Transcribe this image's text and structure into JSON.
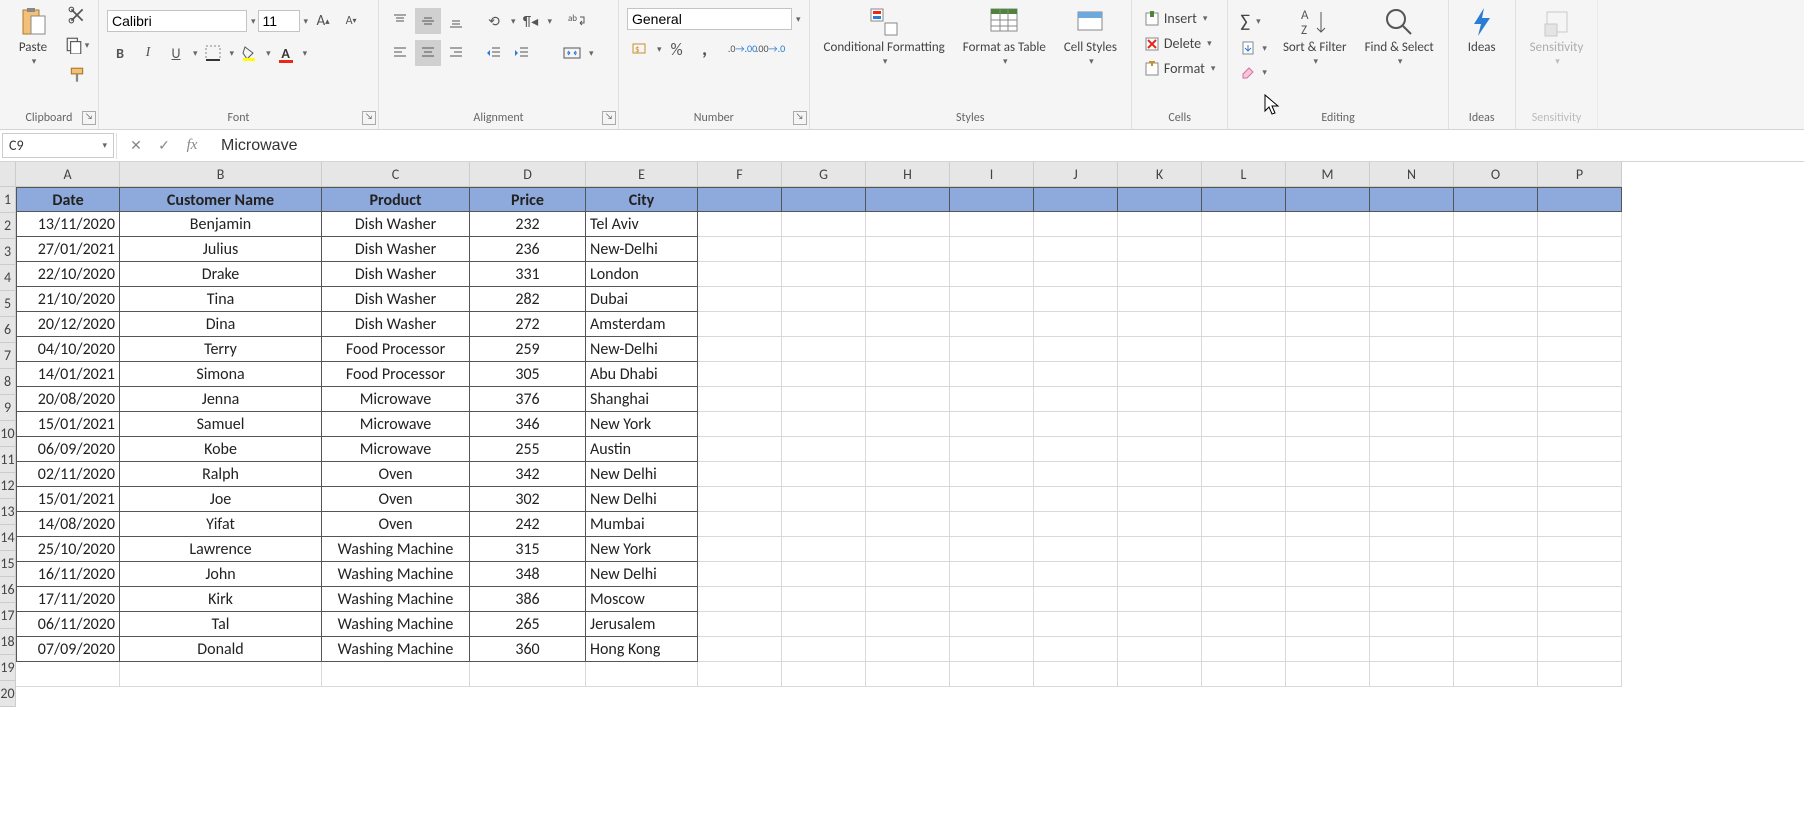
{
  "ribbon": {
    "clipboard": {
      "label": "Clipboard",
      "paste": "Paste"
    },
    "font": {
      "label": "Font",
      "name": "Calibri",
      "size": "11"
    },
    "alignment": {
      "label": "Alignment"
    },
    "number": {
      "label": "Number",
      "format": "General"
    },
    "styles": {
      "label": "Styles",
      "conditional": "Conditional Formatting",
      "format_table": "Format as Table",
      "cell_styles": "Cell Styles"
    },
    "cells": {
      "label": "Cells",
      "insert": "Insert",
      "delete": "Delete",
      "format": "Format"
    },
    "editing": {
      "label": "Editing",
      "sort": "Sort & Filter",
      "find": "Find & Select"
    },
    "ideas": {
      "label": "Ideas",
      "btn": "Ideas"
    },
    "sensitivity": {
      "label": "Sensitivity",
      "btn": "Sensitivity"
    }
  },
  "formula_bar": {
    "name_box": "C9",
    "formula": "Microwave"
  },
  "columns": [
    "A",
    "B",
    "C",
    "D",
    "E",
    "F",
    "G",
    "H",
    "I",
    "J",
    "K",
    "L",
    "M",
    "N",
    "O",
    "P"
  ],
  "headers": [
    "Date",
    "Customer Name",
    "Product",
    "Price",
    "City"
  ],
  "rows": [
    {
      "n": 1
    },
    {
      "n": 2,
      "date": "13/11/2020",
      "name": "Benjamin",
      "product": "Dish Washer",
      "price": "232",
      "city": "Tel Aviv"
    },
    {
      "n": 3,
      "date": "27/01/2021",
      "name": "Julius",
      "product": "Dish Washer",
      "price": "236",
      "city": "New-Delhi"
    },
    {
      "n": 4,
      "date": "22/10/2020",
      "name": "Drake",
      "product": "Dish Washer",
      "price": "331",
      "city": "London"
    },
    {
      "n": 5,
      "date": "21/10/2020",
      "name": "Tina",
      "product": "Dish Washer",
      "price": "282",
      "city": "Dubai"
    },
    {
      "n": 6,
      "date": "20/12/2020",
      "name": "Dina",
      "product": "Dish Washer",
      "price": "272",
      "city": "Amsterdam"
    },
    {
      "n": 7,
      "date": "04/10/2020",
      "name": "Terry",
      "product": "Food Processor",
      "price": "259",
      "city": "New-Delhi"
    },
    {
      "n": 8,
      "date": "14/01/2021",
      "name": "Simona",
      "product": "Food Processor",
      "price": "305",
      "city": "Abu Dhabi"
    },
    {
      "n": 9,
      "date": "20/08/2020",
      "name": "Jenna",
      "product": "Microwave",
      "price": "376",
      "city": "Shanghai"
    },
    {
      "n": 10,
      "date": "15/01/2021",
      "name": "Samuel",
      "product": "Microwave",
      "price": "346",
      "city": "New York"
    },
    {
      "n": 11,
      "date": "06/09/2020",
      "name": "Kobe",
      "product": "Microwave",
      "price": "255",
      "city": "Austin"
    },
    {
      "n": 12,
      "date": "02/11/2020",
      "name": "Ralph",
      "product": "Oven",
      "price": "342",
      "city": "New Delhi"
    },
    {
      "n": 13,
      "date": "15/01/2021",
      "name": "Joe",
      "product": "Oven",
      "price": "302",
      "city": "New Delhi"
    },
    {
      "n": 14,
      "date": "14/08/2020",
      "name": "Yifat",
      "product": "Oven",
      "price": "242",
      "city": "Mumbai"
    },
    {
      "n": 15,
      "date": "25/10/2020",
      "name": "Lawrence",
      "product": "Washing Machine",
      "price": "315",
      "city": "New York"
    },
    {
      "n": 16,
      "date": "16/11/2020",
      "name": "John",
      "product": "Washing Machine",
      "price": "348",
      "city": "New Delhi"
    },
    {
      "n": 17,
      "date": "17/11/2020",
      "name": "Kirk",
      "product": "Washing Machine",
      "price": "386",
      "city": "Moscow"
    },
    {
      "n": 18,
      "date": "06/11/2020",
      "name": "Tal",
      "product": "Washing Machine",
      "price": "265",
      "city": "Jerusalem"
    },
    {
      "n": 19,
      "date": "07/09/2020",
      "name": "Donald",
      "product": "Washing Machine",
      "price": "360",
      "city": "Hong Kong"
    },
    {
      "n": 20
    }
  ]
}
